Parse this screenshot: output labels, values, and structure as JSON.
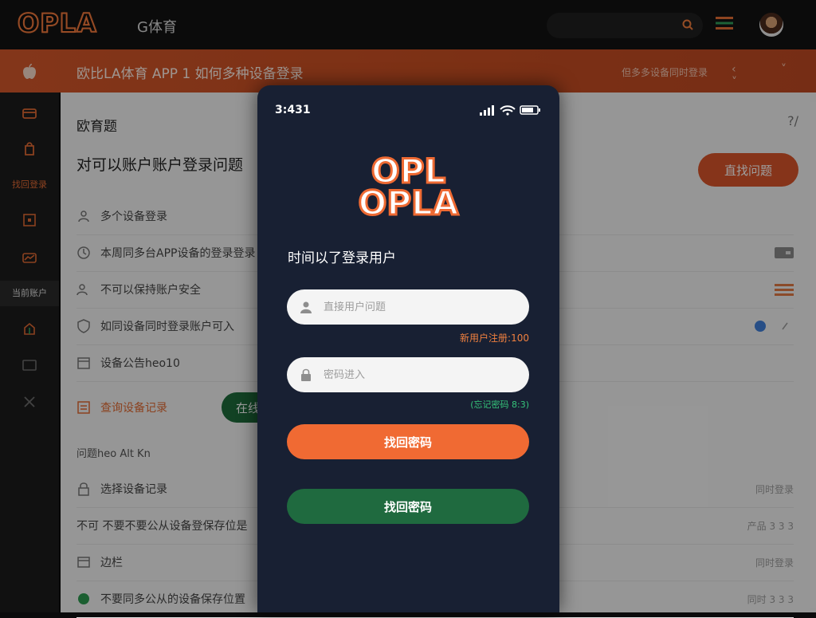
{
  "colors": {
    "accent": "#ee6a33",
    "banner": "#d4572a",
    "success": "#1f6a3f",
    "phone_bg": "#182033"
  },
  "topbar": {
    "logo": "OPLA",
    "logo_sub": "G体育",
    "search": {
      "placeholder": ""
    },
    "menu_icon": "hamburger-icon",
    "avatar_icon": "user-avatar"
  },
  "banner": {
    "title": "欧比LA体育 APP 1 如何多种设备登录",
    "right_text": "但多多设备同时登录",
    "chevrons": "‹ ˅ ˅"
  },
  "sidebar": {
    "items": [
      {
        "icon": "wallet-icon",
        "label": ""
      },
      {
        "icon": "bag-icon",
        "label": ""
      },
      {
        "icon": "",
        "label": "找回登录"
      },
      {
        "icon": "box-icon",
        "label": ""
      },
      {
        "icon": "chart-icon",
        "label": ""
      },
      {
        "icon": "",
        "label": "当前账户"
      },
      {
        "icon": "gift-icon",
        "label": ""
      },
      {
        "icon": "screen-icon",
        "label": ""
      },
      {
        "icon": "tools-icon",
        "label": ""
      }
    ]
  },
  "main": {
    "heading": "欧育题",
    "heading_right": "?/",
    "subheading": "对可以账户账户登录问题",
    "cta": "直找问题",
    "rows": [
      {
        "icon": "devices-icon",
        "text": "多个设备登录",
        "right": ""
      },
      {
        "icon": "clock-icon",
        "text": "本周同多台APP设备的登录登录",
        "right": ""
      },
      {
        "icon": "users-icon",
        "text": "不可以保持账户安全",
        "right": ""
      },
      {
        "icon": "shield-icon",
        "text": "如同设备同时登录账户可入",
        "right": ""
      },
      {
        "icon": "calendar-icon",
        "text": "设备公告heo10",
        "right": ""
      },
      {
        "icon": "doc-icon",
        "text": "查询设备记录",
        "right": ""
      }
    ],
    "green_btn": "在线",
    "section_title": "问题heo Alt Kn",
    "rows2": [
      {
        "icon": "lock-icon",
        "text": "选择设备记录",
        "right": "同时登录"
      },
      {
        "icon": "",
        "text": "不可 不要不要公从设备登保存位是",
        "right": "产品 3 3 3"
      },
      {
        "icon": "file-icon",
        "text": "边栏",
        "right": "同时登录"
      },
      {
        "icon": "chat-icon",
        "text": "不要同多公从的设备保存位置",
        "right": "同时 3 3 3"
      }
    ]
  },
  "phone": {
    "time": "3:431",
    "logo_line1": "OPL",
    "logo_line2": "OPLA",
    "heading": "时间以了登录用户",
    "username": {
      "placeholder": "直接用户问题",
      "value": ""
    },
    "username_hint": "新用户注册:100",
    "password": {
      "placeholder": "密码进入",
      "value": ""
    },
    "password_hint": "(忘记密码 8:3)",
    "primary_button": "找回密码",
    "secondary_button": "找回密码"
  }
}
